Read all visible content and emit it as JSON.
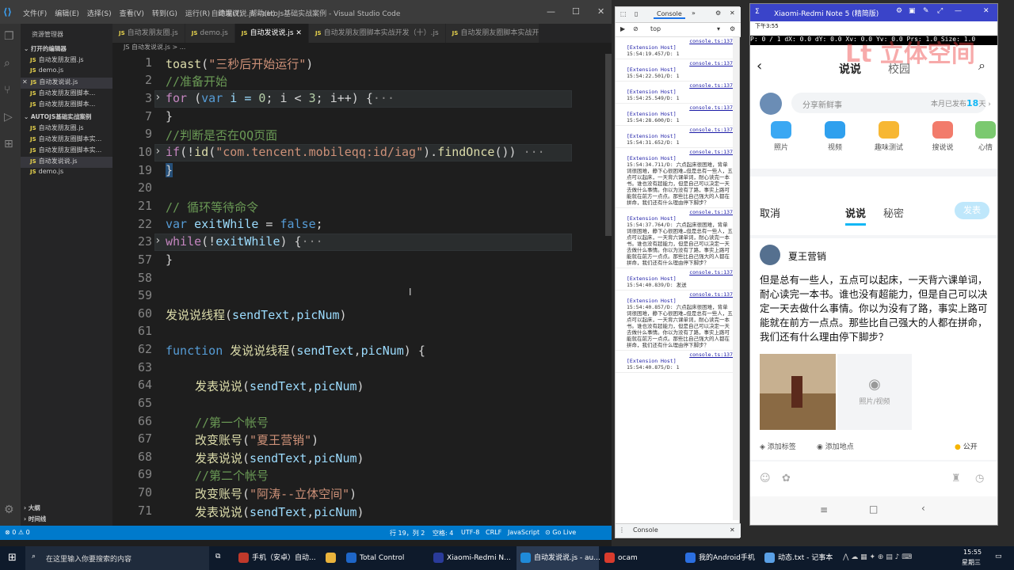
{
  "vscode": {
    "menu": [
      "文件(F)",
      "编辑(E)",
      "选择(S)",
      "查看(V)",
      "转到(G)",
      "运行(R)",
      "终端(T)",
      "帮助(H)"
    ],
    "window_title": "自动发说说.js - autoJs基础实战案例 - Visual Studio Code",
    "sidebar": {
      "header": "资源管理器",
      "open_editors_label": "打开的编辑器",
      "open_editors": [
        "自动发朋友圈.js",
        "demo.js",
        "自动发说说.js",
        "自动发朋友圈脚本...",
        "自动发朋友圈脚本..."
      ],
      "project_label": "AUTOJS基础实战案例",
      "project_files": [
        "自动发朋友圈.js",
        "自动发朋友圈脚本实...",
        "自动发朋友圈脚本实...",
        "自动发说说.js",
        "demo.js"
      ],
      "outline_label": "大纲",
      "timeline_label": "时间线"
    },
    "tabs": [
      "自动发朋友圈.js",
      "demo.js",
      "自动发说说.js",
      "自动发朋友圈脚本实战开发（十）.js",
      "自动发朋友圈脚本实战开"
    ],
    "breadcrumb": "JS 自动发说说.js > ...",
    "line_numbers": [
      "1",
      "2",
      "3",
      "7",
      "9",
      "10",
      "19",
      "20",
      "21",
      "22",
      "23",
      "57",
      "58",
      "59",
      "60",
      "61",
      "62",
      "63",
      "64",
      "65",
      "66",
      "67",
      "68",
      "69",
      "70",
      "71"
    ],
    "code": {
      "l1_fn": "toast",
      "l1_open": "(",
      "l1_str": "\"三秒后开始运行\"",
      "l1_close": ")",
      "l2": "//准备开始",
      "l3_kw": "for",
      "l3_a": " (",
      "l3_var": "var",
      "l3_b": " i = ",
      "l3_n0": "0",
      "l3_c": "; i < ",
      "l3_n3": "3",
      "l3_d": "; i++) {",
      "l3_e": "···",
      "l7": "}",
      "l9": "//判断是否在QQ页面",
      "l10_kw": "if",
      "l10_a": "(!",
      "l10_fn": "id",
      "l10_b": "(",
      "l10_str": "\"com.tencent.mobileqq:id/iag\"",
      "l10_c": ").",
      "l10_fn2": "findOnce",
      "l10_d": "()) ",
      "l10_e": "···",
      "l19": "}",
      "l21": "// 循环等待命令",
      "l22_kw": "var",
      "l22_id": " exitWhile",
      "l22_a": " = ",
      "l22_val": "false",
      "l22_b": ";",
      "l23_kw": "while",
      "l23_a": "(!",
      "l23_id": "exitWhile",
      "l23_b": ") {",
      "l23_e": "···",
      "l57": "}",
      "l60_fn": "发说说线程",
      "l60_a": "(",
      "l60_id": "sendText",
      "l60_b": ",",
      "l60_id2": "picNum",
      "l60_c": ")",
      "l62_kw": "function",
      "l62_fn": " 发说说线程",
      "l62_a": "(",
      "l62_id": "sendText",
      "l62_b": ",",
      "l62_id2": "picNum",
      "l62_c": ") {",
      "l64_fn": "发表说说",
      "l64_a": "(",
      "l64_id": "sendText",
      "l64_b": ",",
      "l64_id2": "picNum",
      "l64_c": ")",
      "l66": "//第一个帐号",
      "l67_fn": "改变账号",
      "l67_a": "(",
      "l67_str": "\"夏王营销\"",
      "l67_b": ")",
      "l68_fn": "发表说说",
      "l68_a": "(",
      "l68_id": "sendText",
      "l68_b": ",",
      "l68_id2": "picNum",
      "l68_c": ")",
      "l69": "//第二个帐号",
      "l70_fn": "改变账号",
      "l70_a": "(",
      "l70_str": "\"阿涛--立体空间\"",
      "l70_b": ")",
      "l71_fn": "发表说说",
      "l71_a": "(",
      "l71_id": "sendText",
      "l71_b": ",",
      "l71_id2": "picNum",
      "l71_c": ")"
    },
    "status": {
      "errors": "⊗ 0 ⚠ 0",
      "position": "行 19，列 2",
      "spaces": "空格: 4",
      "encoding": "UTF-8",
      "eol": "CRLF",
      "language": "JavaScript",
      "golive": "⊙ Go Live"
    }
  },
  "devtools": {
    "tab_console": "Console",
    "context": "top",
    "logs": [
      {
        "src": "console.ts:137",
        "host": "[Extension Host]",
        "text": "15:54:19.457/D: 1"
      },
      {
        "src": "console.ts:137",
        "host": "[Extension Host]",
        "text": "15:54:22.501/D: 1"
      },
      {
        "src": "console.ts:137",
        "host": "[Extension Host]",
        "text": "15:54:25.549/D: 1"
      },
      {
        "src": "console.ts:137",
        "host": "[Extension Host]",
        "text": "15:54:28.600/D: 1"
      },
      {
        "src": "console.ts:137",
        "host": "[Extension Host]",
        "text": "15:54:31.652/D: 1"
      },
      {
        "src": "console.ts:137",
        "host": "[Extension Host]",
        "text": "15:54:34.711/D: 六点起床很困难，背单词很困难，静下心很困难…但是总有一些人，五点可以起床，一天背六课单词，耐心读完一本书。谁也没有超能力，但是自己可以决定一天去做什么事情。你以为没有了路，事实上路可能就在前方一点点。那些比自己强大的人都在拼命，我们还有什么理由停下脚步？"
      },
      {
        "src": "console.ts:137",
        "host": "[Extension Host]",
        "text": "15:54:37.764/D: 六点起床很困难，背单词很困难，静下心很困难…但是总有一些人，五点可以起床，一天背六课单词，耐心读完一本书。谁也没有超能力，但是自己可以决定一天去做什么事情。你以为没有了路，事实上路可能就在前方一点点。那些比自己强大的人都在拼命，我们还有什么理由停下脚步？"
      },
      {
        "src": "console.ts:137",
        "host": "[Extension Host]",
        "text": "15:54:40.839/D: 发送"
      },
      {
        "src": "console.ts:137",
        "host": "[Extension Host]",
        "text": "15:54:40.857/D: 六点起床很困难，背单词很困难，静下心很困难…但是总有一些人，五点可以起床，一天背六课单词，耐心读完一本书。谁也没有超能力，但是自己可以决定一天去做什么事情。你以为没有了路，事实上路可能就在前方一点点。那些比自己强大的人都在拼命，我们还有什么理由停下脚步？"
      },
      {
        "src": "console.ts:137",
        "host": "[Extension Host]",
        "text": "15:54:40.875/D: 1"
      }
    ],
    "footer_tab": "Console"
  },
  "phone": {
    "window_title": "Xiaomi-Redmi Note 5 (精简版)",
    "status_time": "下午3:55",
    "pointer_bar": "P: 0 / 1    dX: 0.0    dY: 0.0    Xv: 0.0    Yv: 0.0    Prs: 1.0    Size: 1.0",
    "watermark": "Lt 立体空间",
    "nav_tab_active": "说说",
    "nav_tab_other": "校园",
    "share_placeholder": "分享新鲜事",
    "share_count_prefix": "本月已发布",
    "share_count": "18",
    "share_count_suffix": "天",
    "icons": [
      "照片",
      "视频",
      "趣味测试",
      "搜说说",
      "心情"
    ],
    "post_cancel": "取消",
    "post_tab_active": "说说",
    "post_tab_other": "秘密",
    "post_publish": "发表",
    "account_name": "夏王营销",
    "post_text": "但是总有一些人，五点可以起床，一天背六课单词，耐心读完一本书。谁也没有超能力，但是自己可以决定一天去做什么事情。你以为没有了路，事实上路可能就在前方一点点。那些比自己强大的人都在拼命，我们还有什么理由停下脚步？",
    "photo_video_label": "照片/视频",
    "tag_label": "添加标签",
    "location_label": "添加地点",
    "visibility_label": "公开"
  },
  "taskbar": {
    "search_placeholder": "在这里输入你要搜索的内容",
    "items": [
      {
        "label": "手机（安卓）自动...",
        "color": "#c0392b"
      },
      {
        "label": "",
        "color": "#e9b33c"
      },
      {
        "label": "Total Control",
        "color": "#1e66c8"
      },
      {
        "label": "Xiaomi-Redmi N...",
        "color": "#2a3b9a"
      },
      {
        "label": "自动发说说.js - au...",
        "color": "#1f8ad8"
      },
      {
        "label": "ocam",
        "color": "#d83b2d"
      },
      {
        "label": "我的Android手机",
        "color": "#2b6fe0"
      },
      {
        "label": "动态.txt - 记事本",
        "color": "#5aa0e6"
      }
    ],
    "time": "15:55",
    "weekday": "星期三"
  }
}
